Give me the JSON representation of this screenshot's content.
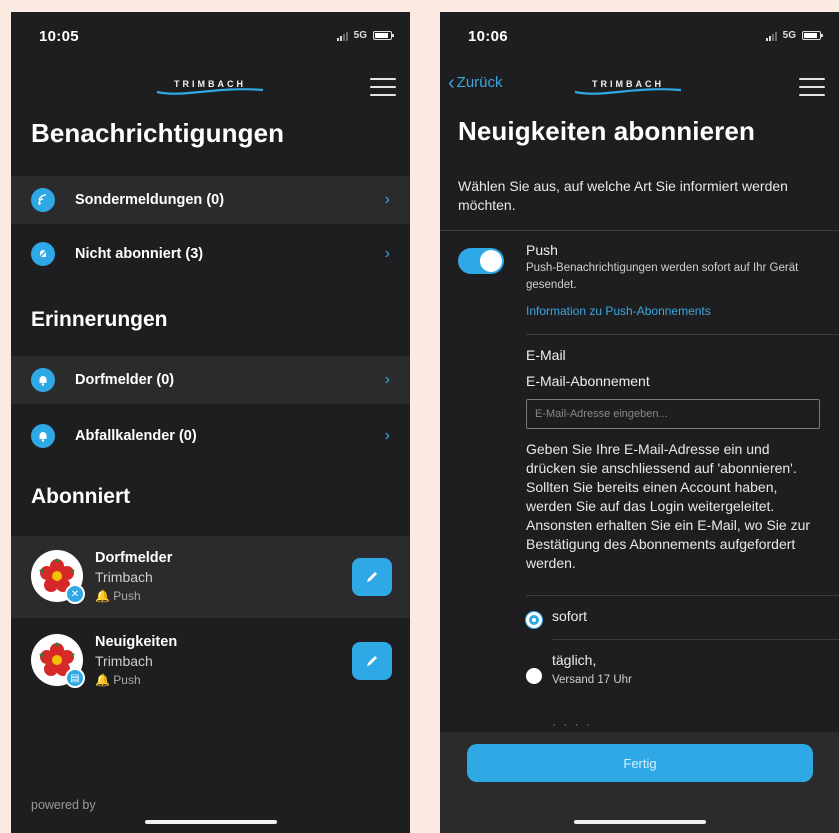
{
  "left": {
    "status": {
      "time": "10:05",
      "network": "5G"
    },
    "logo": "TRIMBACH",
    "title": "Benachrichtigungen",
    "notifications": [
      {
        "icon": "wifi-icon",
        "label": "Sondermeldungen (0)",
        "chevron": "›"
      },
      {
        "icon": "bell-slash-icon",
        "label": "Nicht abonniert (3)",
        "chevron": "›"
      }
    ],
    "reminders_title": "Erinnerungen",
    "reminders": [
      {
        "icon": "bell-icon",
        "label": "Dorfmelder (0)",
        "chevron": "›"
      },
      {
        "icon": "bell-icon",
        "label": "Abfallkalender (0)",
        "chevron": "›"
      }
    ],
    "subscribed_title": "Abonniert",
    "subscriptions": [
      {
        "title": "Dorfmelder",
        "org": "Trimbach",
        "type": "🔔 Push",
        "badge_icon": "tools-icon"
      },
      {
        "title": "Neuigkeiten",
        "org": "Trimbach",
        "type": "🔔 Push",
        "badge_icon": "newspaper-icon"
      }
    ],
    "footer": "powered by"
  },
  "right": {
    "status": {
      "time": "10:06",
      "network": "5G"
    },
    "back_label": "Zurück",
    "logo": "TRIMBACH",
    "title": "Neuigkeiten abonnieren",
    "intro": "Wählen Sie aus, auf welche Art Sie informiert werden möchten.",
    "push": {
      "title": "Push",
      "description": "Push-Benachrichtigungen werden sofort auf Ihr Gerät gesendet.",
      "link": "Information zu Push-Abonnements",
      "enabled": true
    },
    "email": {
      "title": "E-Mail",
      "subtitle": "E-Mail-Abonnement",
      "placeholder": "E-Mail-Adresse eingeben...",
      "help": "Geben Sie Ihre E-Mail-Adresse ein und drücken sie anschliessend auf 'abonnieren'. Sollten Sie bereits einen Account haben, werden Sie auf das Login weitergeleitet. Ansonsten erhalten Sie ein E-Mail, wo Sie zur Bestätigung des Abonnements aufgefordert werden."
    },
    "frequency": [
      {
        "label": "sofort",
        "checked": true
      },
      {
        "label": "täglich,",
        "sub": "Versand 17 Uhr",
        "checked": false
      }
    ],
    "done_label": "Fertig"
  },
  "colors": {
    "accent": "#2fa8e6",
    "background": "#1e1e20",
    "shaded_row": "#2b2b2d",
    "page_bg": "#fbeae2"
  }
}
